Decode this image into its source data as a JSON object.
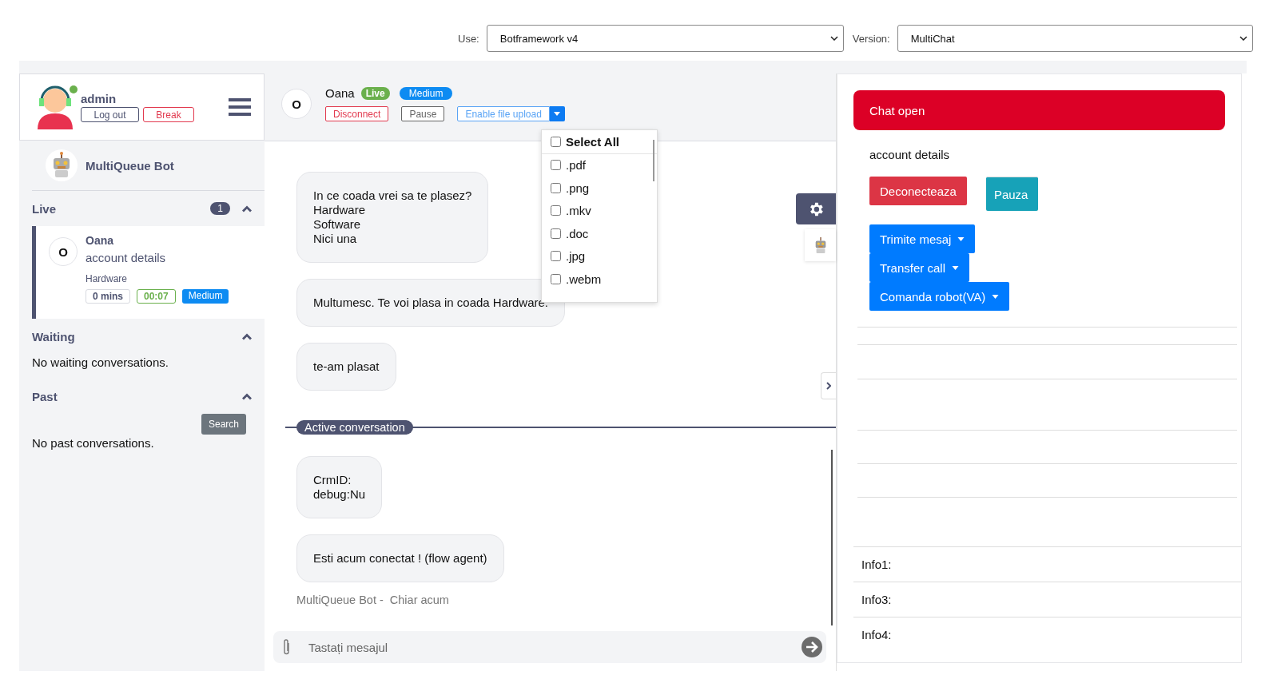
{
  "toolbar": {
    "use_label": "Use:",
    "use_value": "Botframework v4",
    "version_label": "Version:",
    "version_value": "MultiChat"
  },
  "agent": {
    "name": "admin",
    "online": true,
    "logout": "Log out",
    "break": "Break"
  },
  "bot": {
    "name": "MultiQueue Bot"
  },
  "sections": [
    {
      "title": "Live",
      "count": "1",
      "expanded": true,
      "conversations": [
        {
          "initial": "O",
          "name": "Oana",
          "subject": "account details",
          "queue": "Hardware",
          "selected": true,
          "tags": [
            {
              "label": "0 mins",
              "kind": "plain"
            },
            {
              "label": "00:07",
              "kind": "timer"
            },
            {
              "label": "Medium",
              "kind": "priority"
            }
          ]
        }
      ]
    },
    {
      "title": "Waiting",
      "expanded": true,
      "empty_text": "No waiting conversations."
    },
    {
      "title": "Past",
      "expanded": true,
      "search_button": "Search",
      "empty_text": "No past conversations."
    }
  ],
  "chat_header": {
    "initial": "O",
    "name": "Oana",
    "badges": [
      {
        "label": "Live",
        "kind": "live"
      },
      {
        "label": "Medium",
        "kind": "priority"
      }
    ],
    "disconnect": "Disconnect",
    "pause": "Pause",
    "file_upload": "Enable file upload"
  },
  "file_types": {
    "select_all": {
      "label": "Select All",
      "checked": false
    },
    "items": [
      {
        "label": ".pdf",
        "checked": false
      },
      {
        "label": ".png",
        "checked": false
      },
      {
        "label": ".mkv",
        "checked": false
      },
      {
        "label": ".doc",
        "checked": false
      },
      {
        "label": ".jpg",
        "checked": false
      },
      {
        "label": ".webm",
        "checked": false
      }
    ]
  },
  "messages_before": [
    "In ce coada vrei sa te plasez?\nHardware\nSoftware\nNici una",
    "Multumesc. Te voi plasa in coada Hardware.",
    "te-am plasat"
  ],
  "divider": "Active conversation",
  "messages_after": [
    "CrmID:\ndebug:Nu",
    "Esti acum conectat ! (flow agent)"
  ],
  "meta": {
    "sender": "MultiQueue Bot -",
    "time": "Chiar acum"
  },
  "composer": {
    "placeholder": "Tastați mesajul"
  },
  "side_panel": {
    "title": "Chat open",
    "subtitle": "account details",
    "buttons": [
      {
        "label": "Deconecteaza",
        "kind": "danger"
      },
      {
        "label": "Pauza",
        "kind": "info"
      }
    ],
    "dropdowns": [
      "Trimite mesaj",
      "Transfer call",
      "Comanda robot(VA)"
    ],
    "info": [
      "Info1:",
      "Info3:",
      "Info4:"
    ]
  }
}
